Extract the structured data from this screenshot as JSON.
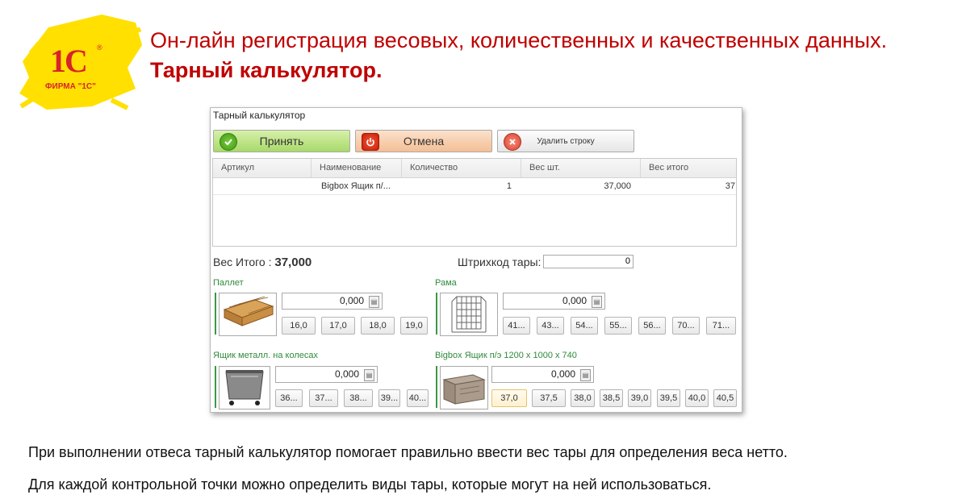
{
  "logo": {
    "text": "1С",
    "caption": "ФИРМА \"1С\""
  },
  "slide": {
    "title_regular": "Он-лайн регистрация весовых, количественных и качественных данных. ",
    "title_bold": "Тарный калькулятор."
  },
  "window": {
    "title": "Тарный калькулятор",
    "buttons": {
      "accept": "Принять",
      "cancel": "Отмена",
      "delete_row": "Удалить строку"
    },
    "table": {
      "columns": [
        "Артикул",
        "Наименование",
        "Количество",
        "Вес шт.",
        "Вес итого"
      ],
      "rows": [
        {
          "article": "",
          "name": "Bigbox Ящик п/...",
          "qty": "1",
          "unit_weight": "37,000",
          "total_weight": "37,"
        }
      ]
    },
    "total": {
      "label": "Вес Итого :",
      "value": "37,000"
    },
    "barcode": {
      "label": "Штрихкод тары:",
      "value": "0"
    },
    "groups": [
      {
        "title": "Паллет",
        "image": "pallet-image",
        "value": "0,000",
        "chips": [
          "16,0",
          "17,0",
          "18,0",
          "19,0"
        ]
      },
      {
        "title": "Рама",
        "image": "frame-image",
        "value": "0,000",
        "chips": [
          "41...",
          "43...",
          "54...",
          "55...",
          "56...",
          "70...",
          "71..."
        ]
      },
      {
        "title": "Ящик металл. на колесах",
        "image": "metal-box-image",
        "value": "0,000",
        "chips": [
          "36...",
          "37...",
          "38...",
          "39...",
          "40..."
        ]
      },
      {
        "title": "Bigbox Ящик п/э 1200 х 1000 х 740",
        "image": "bigbox-image",
        "value": "0,000",
        "chips": [
          "37,0",
          "37,5",
          "38,0",
          "38,5",
          "39,0",
          "39,5",
          "40,0",
          "40,5"
        ],
        "selected_chip": "37,0"
      }
    ],
    "calc_icon": "calculator-icon"
  },
  "captions": [
    "При выполнении отвеса тарный калькулятор помогает правильно ввести вес тары для определения веса нетто.",
    "Для каждой контрольной точки можно определить виды тары, которые могут на ней использоваться."
  ],
  "colors": {
    "title_red": "#c00000",
    "group_green": "#2f8a3a",
    "logo_yellow": "#ffe000",
    "logo_red": "#d8232a"
  }
}
